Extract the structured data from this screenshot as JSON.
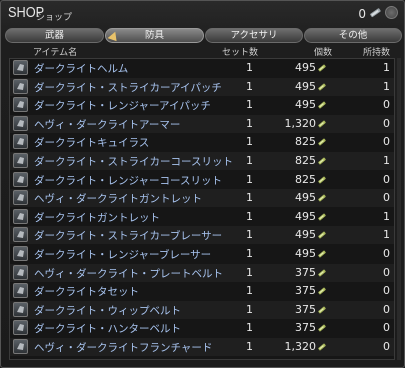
{
  "window": {
    "title": "SHOP",
    "subtitle": "ショップ",
    "gil": "0"
  },
  "tabs": [
    {
      "label": "武器"
    },
    {
      "label": "防具"
    },
    {
      "label": "アクセサリ"
    },
    {
      "label": "その他"
    }
  ],
  "active_tab": "防具",
  "columns": {
    "name": "アイテム名",
    "set": "セット数",
    "price": "個数",
    "owned": "所持数"
  },
  "items": [
    {
      "name": "ダークライトヘルム",
      "set": "1",
      "price": "495",
      "owned": "1",
      "icon": "helmet-icon"
    },
    {
      "name": "ダークライト・ストライカーアイパッチ",
      "set": "1",
      "price": "495",
      "owned": "1",
      "icon": "eyepatch-icon"
    },
    {
      "name": "ダークライト・レンジャーアイパッチ",
      "set": "1",
      "price": "495",
      "owned": "0",
      "icon": "eyepatch-icon"
    },
    {
      "name": "ヘヴィ・ダークライトアーマー",
      "set": "1",
      "price": "1,320",
      "owned": "0",
      "icon": "armor-icon"
    },
    {
      "name": "ダークライトキュイラス",
      "set": "1",
      "price": "825",
      "owned": "0",
      "icon": "armor-icon"
    },
    {
      "name": "ダークライト・ストライカーコースリット",
      "set": "1",
      "price": "825",
      "owned": "1",
      "icon": "coat-icon"
    },
    {
      "name": "ダークライト・レンジャーコースリット",
      "set": "1",
      "price": "825",
      "owned": "0",
      "icon": "coat-icon"
    },
    {
      "name": "ヘヴィ・ダークライトガントレット",
      "set": "1",
      "price": "495",
      "owned": "0",
      "icon": "gauntlet-icon"
    },
    {
      "name": "ダークライトガントレット",
      "set": "1",
      "price": "495",
      "owned": "1",
      "icon": "gauntlet-icon"
    },
    {
      "name": "ダークライト・ストライカーブレーサー",
      "set": "1",
      "price": "495",
      "owned": "1",
      "icon": "bracer-icon"
    },
    {
      "name": "ダークライト・レンジャーブレーサー",
      "set": "1",
      "price": "495",
      "owned": "0",
      "icon": "bracer-icon"
    },
    {
      "name": "ヘヴィ・ダークライト・プレートベルト",
      "set": "1",
      "price": "375",
      "owned": "0",
      "icon": "belt-icon"
    },
    {
      "name": "ダークライトタセット",
      "set": "1",
      "price": "375",
      "owned": "0",
      "icon": "belt-icon"
    },
    {
      "name": "ダークライト・ウィップベルト",
      "set": "1",
      "price": "375",
      "owned": "0",
      "icon": "belt-icon"
    },
    {
      "name": "ダークライト・ハンターベルト",
      "set": "1",
      "price": "375",
      "owned": "0",
      "icon": "belt-icon"
    },
    {
      "name": "ヘヴィ・ダークライトフランチャード",
      "set": "1",
      "price": "1,320",
      "owned": "0",
      "icon": "leg-armor-icon"
    }
  ]
}
